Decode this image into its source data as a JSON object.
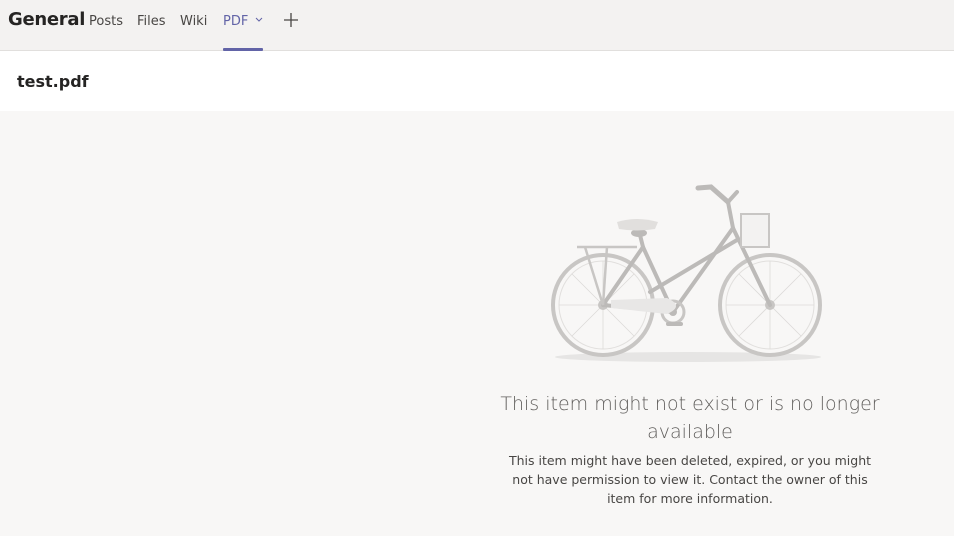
{
  "header": {
    "channel_title": "General",
    "tabs": [
      {
        "label": "Posts",
        "active": false
      },
      {
        "label": "Files",
        "active": false
      },
      {
        "label": "Wiki",
        "active": false
      },
      {
        "label": "PDF",
        "active": true
      }
    ],
    "add_tab_icon": "plus-icon",
    "tab_menu_icon": "chevron-down-icon"
  },
  "file": {
    "name": "test.pdf"
  },
  "error": {
    "illustration": "bicycle-illustration",
    "title": "This item might not exist or is no longer available",
    "description": "This item might have been deleted, expired, or you might not have permission to view it. Contact the owner of this item for more information."
  },
  "colors": {
    "accent": "#6264a7",
    "topbar_bg": "#f3f2f1",
    "content_bg": "#f8f7f6"
  }
}
